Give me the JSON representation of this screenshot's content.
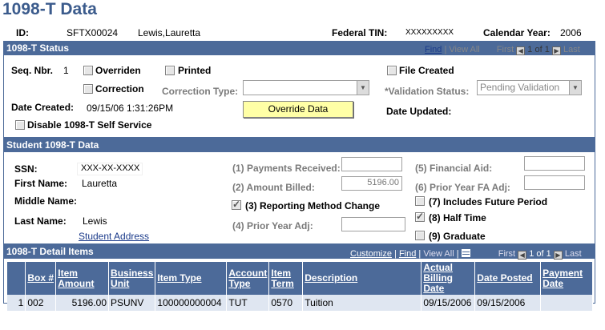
{
  "page": {
    "title": "1098-T Data",
    "id_label": "ID:",
    "id_value": "SFTX00024",
    "name": "Lewis,Lauretta",
    "tin_label": "Federal TIN:",
    "tin_value": "XXXXXXXXX",
    "year_label": "Calendar Year:",
    "year_value": "2006"
  },
  "status": {
    "header": "1098-T Status",
    "nav": {
      "find": "Find",
      "view_all": "View All",
      "first": "First",
      "count": "1 of 1",
      "last": "Last"
    },
    "seq_label": "Seq. Nbr.",
    "seq_value": "1",
    "overriden_label": "Overriden",
    "printed_label": "Printed",
    "file_created_label": "File Created",
    "correction_label": "Correction",
    "correction_type_label": "Correction Type:",
    "correction_type_value": "",
    "validation_status_label": "*Validation Status:",
    "validation_status_value": "Pending Validation",
    "date_created_label": "Date Created:",
    "date_created_value": "09/15/06  1:31:26PM",
    "override_button": "Override Data",
    "date_updated_label": "Date Updated:",
    "disable_self_service_label": "Disable 1098-T Self Service"
  },
  "student": {
    "header": "Student 1098-T Data",
    "ssn_label": "SSN:",
    "ssn_value": "XXX-XX-XXXX",
    "first_name_label": "First Name:",
    "first_name_value": "Lauretta",
    "middle_name_label": "Middle Name:",
    "last_name_label": "Last Name:",
    "last_name_value": "Lewis",
    "address_link": "Student Address",
    "payments_label": "(1) Payments Received:",
    "payments_value": "",
    "amount_billed_label": "(2) Amount Billed:",
    "amount_billed_value": "5196.00",
    "reporting_change_label": "(3) Reporting Method Change",
    "prior_year_adj_label": "(4) Prior Year Adj:",
    "prior_year_adj_value": "",
    "financial_aid_label": "(5) Financial Aid:",
    "financial_aid_value": "",
    "prior_fa_adj_label": "(6) Prior Year FA Adj:",
    "prior_fa_adj_value": "",
    "future_period_label": "(7) Includes Future Period",
    "half_time_label": "(8) Half Time",
    "graduate_label": "(9) Graduate"
  },
  "detail": {
    "header": "1098-T Detail Items",
    "nav": {
      "customize": "Customize",
      "find": "Find",
      "view_all": "View All",
      "first": "First",
      "count": "1 of 1",
      "last": "Last"
    },
    "columns": [
      "Box #",
      "Item Amount",
      "Business Unit",
      "Item Type",
      "Account Type",
      "Item Term",
      "Description",
      "Actual Billing Date",
      "Date Posted",
      "Payment Date"
    ],
    "rows": [
      {
        "row_num": "1",
        "box": "002",
        "amount": "5196.00",
        "business_unit": "PSUNV",
        "item_type": "100000000004",
        "account_type": "TUT",
        "item_term": "0570",
        "description": "Tuition",
        "actual_billing_date": "09/15/2006",
        "date_posted": "09/15/2006",
        "payment_date": ""
      }
    ]
  },
  "colors": {
    "title": "#3b5b8c",
    "panel_header": "#4c6a99",
    "row_bg": "#dfe6f1",
    "button_bg": "#ffffa6"
  }
}
